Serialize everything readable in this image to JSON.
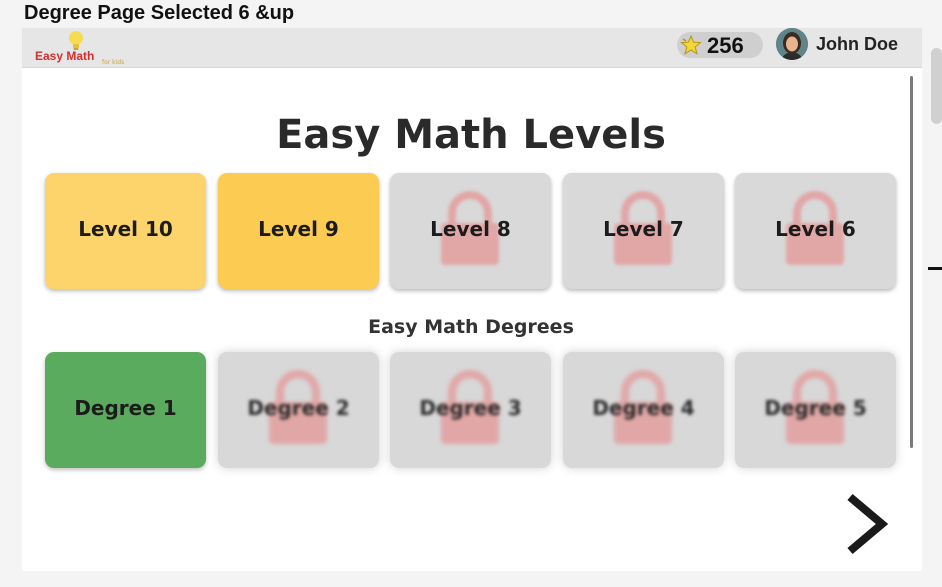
{
  "page_caption": "Degree Page Selected 6 &up",
  "app": {
    "logo_text": "Easy Math",
    "logo_tagline": "for kids"
  },
  "user": {
    "points": "256",
    "name": "John Doe"
  },
  "main_title": "Easy Math Levels",
  "levels": [
    {
      "label": "Level 10",
      "state": "unlocked"
    },
    {
      "label": "Level 9",
      "state": "unlocked"
    },
    {
      "label": "Level 8",
      "state": "locked"
    },
    {
      "label": "Level 7",
      "state": "locked"
    },
    {
      "label": "Level 6",
      "state": "locked"
    }
  ],
  "degrees_title": "Easy Math Degrees",
  "degrees": [
    {
      "label": "Degree 1",
      "state": "selected"
    },
    {
      "label": "Degree 2",
      "state": "locked"
    },
    {
      "label": "Degree 3",
      "state": "locked"
    },
    {
      "label": "Degree 4",
      "state": "locked"
    },
    {
      "label": "Degree 5",
      "state": "locked"
    }
  ],
  "colors": {
    "level_unlocked": "#fdd36b",
    "level_unlocked_alt": "#fccb52",
    "tile_locked": "#d9d9d9",
    "degree_selected": "#5aab5d",
    "lock_icon": "#e49a9a",
    "logo_red": "#d22f2f"
  },
  "icons": {
    "star": "star-icon",
    "lock": "padlock-icon",
    "next": "chevron-right-icon"
  }
}
